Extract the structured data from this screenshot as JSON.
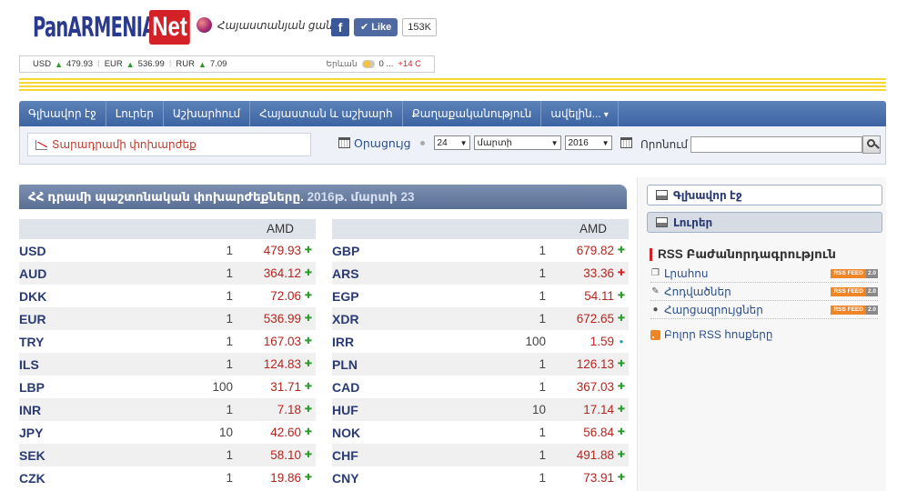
{
  "header": {
    "logo_main": "PanARMENIAN",
    "logo_suffix": "Net",
    "tagline": "Հայաստանյան ցանց",
    "fb_letter": "f",
    "fb_like": "✔ Like",
    "fb_count": "153K"
  },
  "ticker": {
    "items": [
      {
        "code": "USD",
        "value": "479.93"
      },
      {
        "code": "EUR",
        "value": "536.99"
      },
      {
        "code": "RUR",
        "value": "7.09"
      }
    ],
    "city": "Երևան",
    "temp_now": "0 ...",
    "temp_high": "+14 C"
  },
  "nav": {
    "tabs": [
      "Գլխավոր էջ",
      "Լուրեր",
      "Աշխարհում",
      "Հայաստան և աշխարհ",
      "Քաղաքականություն",
      "ավելին..."
    ]
  },
  "toolbar": {
    "converter_label": "Տարադրամի փոխարժեք",
    "calendar_label": "Օրացույց",
    "day": "24",
    "month": "մարտի",
    "year": "2016",
    "search_label": "Որոնում",
    "search_value": ""
  },
  "main": {
    "title": "ՀՀ դրամի պաշտոնական փոխարժեքները.",
    "date": "2016թ. մարտի 23",
    "column_header": "AMD",
    "left_rows": [
      {
        "code": "USD",
        "unit": "1",
        "value": "479.93",
        "trend": "up"
      },
      {
        "code": "AUD",
        "unit": "1",
        "value": "364.12",
        "trend": "up"
      },
      {
        "code": "DKK",
        "unit": "1",
        "value": "72.06",
        "trend": "up"
      },
      {
        "code": "EUR",
        "unit": "1",
        "value": "536.99",
        "trend": "up"
      },
      {
        "code": "TRY",
        "unit": "1",
        "value": "167.03",
        "trend": "up"
      },
      {
        "code": "ILS",
        "unit": "1",
        "value": "124.83",
        "trend": "up"
      },
      {
        "code": "LBP",
        "unit": "100",
        "value": "31.71",
        "trend": "up"
      },
      {
        "code": "INR",
        "unit": "1",
        "value": "7.18",
        "trend": "up"
      },
      {
        "code": "JPY",
        "unit": "10",
        "value": "42.60",
        "trend": "up"
      },
      {
        "code": "SEK",
        "unit": "1",
        "value": "58.10",
        "trend": "up"
      },
      {
        "code": "CZK",
        "unit": "1",
        "value": "19.86",
        "trend": "up"
      }
    ],
    "right_rows": [
      {
        "code": "GBP",
        "unit": "1",
        "value": "679.82",
        "trend": "up"
      },
      {
        "code": "ARS",
        "unit": "1",
        "value": "33.36",
        "trend": "down"
      },
      {
        "code": "EGP",
        "unit": "1",
        "value": "54.11",
        "trend": "up"
      },
      {
        "code": "XDR",
        "unit": "1",
        "value": "672.65",
        "trend": "up"
      },
      {
        "code": "IRR",
        "unit": "100",
        "value": "1.59",
        "trend": "same"
      },
      {
        "code": "PLN",
        "unit": "1",
        "value": "126.13",
        "trend": "up"
      },
      {
        "code": "CAD",
        "unit": "1",
        "value": "367.03",
        "trend": "up"
      },
      {
        "code": "HUF",
        "unit": "10",
        "value": "17.14",
        "trend": "up"
      },
      {
        "code": "NOK",
        "unit": "1",
        "value": "56.84",
        "trend": "up"
      },
      {
        "code": "CHF",
        "unit": "1",
        "value": "491.88",
        "trend": "up"
      },
      {
        "code": "CNY",
        "unit": "1",
        "value": "73.91",
        "trend": "up"
      }
    ]
  },
  "sidebar": {
    "home_label": "Գլխավոր էջ",
    "news_label": "Լուրեր",
    "rss_title": "RSS Բաժանորդագրություն",
    "rss_items": [
      "Լրահոս",
      "Հոդվածներ",
      "Հարցազրույցներ"
    ],
    "rss_badge_a": "RSS FEED",
    "rss_badge_b": "2.0",
    "all_rss": "Բոլոր RSS հոսքերը"
  },
  "colors": {
    "accent": "#3c64a2",
    "value_red": "#b7241e",
    "trend_up": "#2a9a2a",
    "trend_down": "#d42128",
    "trend_same": "#3a8fc2"
  }
}
